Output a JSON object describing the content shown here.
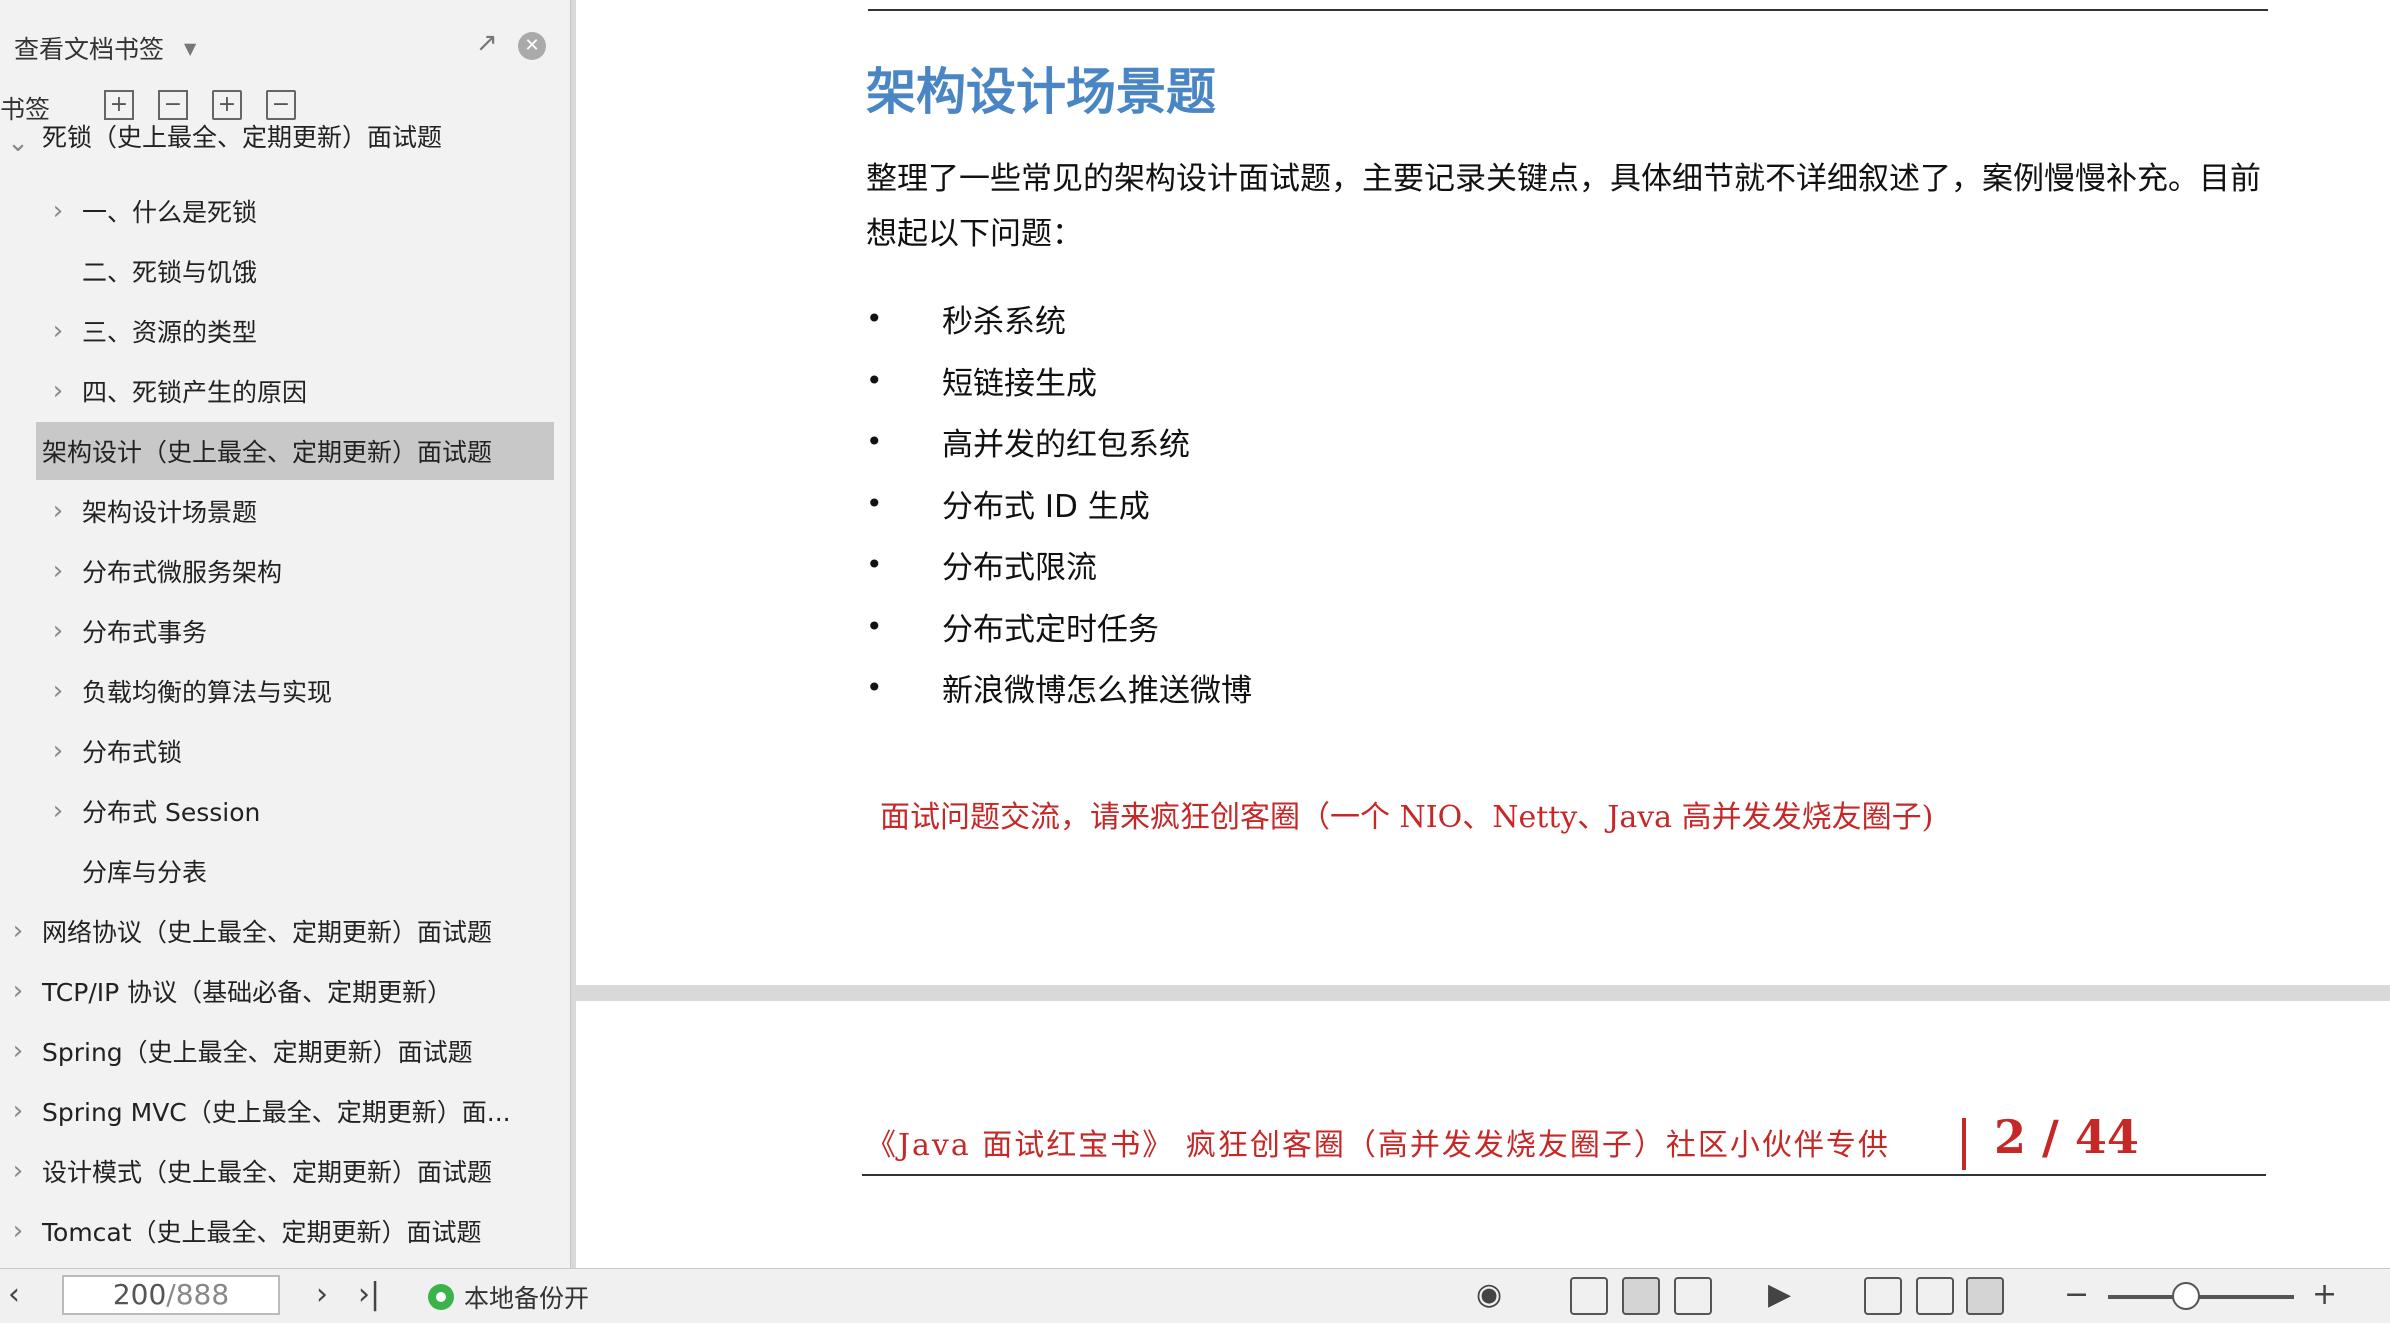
{
  "sidebar": {
    "title": "查看文档书签",
    "tab_label": "书签",
    "tree": [
      {
        "label": "死锁（史上最全、定期更新）面试题",
        "level": 0,
        "expander": "expanded",
        "partial": true
      },
      {
        "label": "一、什么是死锁",
        "level": 1,
        "expander": "collapsed"
      },
      {
        "label": "二、死锁与饥饿",
        "level": 1,
        "expander": "none"
      },
      {
        "label": "三、资源的类型",
        "level": 1,
        "expander": "collapsed"
      },
      {
        "label": "四、死锁产生的原因",
        "level": 1,
        "expander": "collapsed"
      },
      {
        "label": "架构设计（史上最全、定期更新）面试题",
        "level": 0,
        "expander": "expanded",
        "selected": true
      },
      {
        "label": "架构设计场景题",
        "level": 1,
        "expander": "collapsed"
      },
      {
        "label": "分布式微服务架构",
        "level": 1,
        "expander": "collapsed"
      },
      {
        "label": "分布式事务",
        "level": 1,
        "expander": "collapsed"
      },
      {
        "label": "负载均衡的算法与实现",
        "level": 1,
        "expander": "collapsed"
      },
      {
        "label": "分布式锁",
        "level": 1,
        "expander": "collapsed"
      },
      {
        "label": "分布式 Session",
        "level": 1,
        "expander": "collapsed"
      },
      {
        "label": "分库与分表",
        "level": 1,
        "expander": "none"
      },
      {
        "label": "网络协议（史上最全、定期更新）面试题",
        "level": 0,
        "expander": "collapsed"
      },
      {
        "label": "TCP/IP 协议（基础必备、定期更新）",
        "level": 0,
        "expander": "collapsed"
      },
      {
        "label": "Spring（史上最全、定期更新）面试题",
        "level": 0,
        "expander": "collapsed"
      },
      {
        "label": "Spring MVC（史上最全、定期更新）面...",
        "level": 0,
        "expander": "collapsed"
      },
      {
        "label": "设计模式（史上最全、定期更新）面试题",
        "level": 0,
        "expander": "collapsed"
      },
      {
        "label": "Tomcat（史上最全、定期更新）面试题",
        "level": 0,
        "expander": "collapsed"
      }
    ]
  },
  "document": {
    "heading": "架构设计场景题",
    "paragraph": "整理了一些常见的架构设计面试题，主要记录关键点，具体细节就不详细叙述了，案例慢慢补充。目前想起以下问题：",
    "bullets": [
      "秒杀系统",
      "短链接生成",
      "高并发的红包系统",
      "分布式 ID 生成",
      "分布式限流",
      "分布式定时任务",
      "新浪微博怎么推送微博"
    ],
    "note": "面试问题交流，请来疯狂创客圈（一个 NIO、Netty、Java 高并发发烧友圈子)",
    "footer_text": "《Java 面试红宝书》  疯狂创客圈（高并发发烧友圈子）社区小伙伴专供",
    "footer_page": "2 / 44",
    "accent_color": "#4a86c4",
    "note_color": "#c62828"
  },
  "statusbar": {
    "current_page": "200",
    "total_pages": "/888",
    "backup_label": "本地备份开",
    "zoom_level": 0.42
  }
}
